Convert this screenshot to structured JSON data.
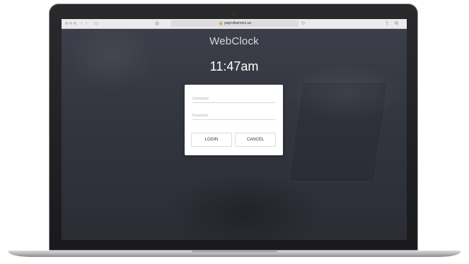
{
  "browser": {
    "url": "payrollservers.us",
    "icons": [
      "traffic-light-dots",
      "back-icon",
      "forward-icon",
      "sidebar-icon",
      "privacy-icon",
      "lock-icon",
      "reload-icon",
      "share-icon",
      "tabs-icon"
    ]
  },
  "page": {
    "brand": "WebClock",
    "time": "11:47am"
  },
  "login": {
    "username_placeholder": "Username",
    "password_placeholder": "Password",
    "login_label": "LOGIN",
    "cancel_label": "CANCEL"
  },
  "colors": {
    "background_overlay": "#33363f",
    "card": "#ffffff",
    "brand_text": "#d7d9de"
  }
}
